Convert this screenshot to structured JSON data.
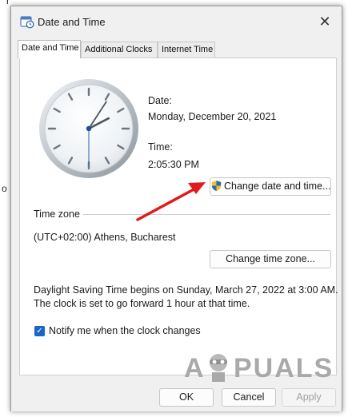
{
  "background": {
    "fragment_top": "r",
    "fragment_left": "o"
  },
  "window": {
    "title": "Date and Time",
    "close_glyph": "✕"
  },
  "tabs": [
    {
      "label": "Date and Time",
      "active": true
    },
    {
      "label": "Additional Clocks",
      "active": false
    },
    {
      "label": "Internet Time",
      "active": false
    }
  ],
  "date": {
    "label": "Date:",
    "value": "Monday, December 20, 2021"
  },
  "time": {
    "label": "Time:",
    "value": "2:05:30 PM",
    "hour": 2,
    "minute": 5,
    "second": 30
  },
  "change_date_time_button": "Change date and time...",
  "time_zone": {
    "heading": "Time zone",
    "value": "(UTC+02:00) Athens, Bucharest",
    "change_button": "Change time zone..."
  },
  "dst": {
    "line1": "Daylight Saving Time begins on Sunday, March 27, 2022 at 3:00 AM.",
    "line2": "The clock is set to go forward 1 hour at that time."
  },
  "notify": {
    "label": "Notify me when the clock changes",
    "checked": true
  },
  "footer": {
    "ok": "OK",
    "cancel": "Cancel",
    "apply": "Apply"
  },
  "watermark": {
    "text_left": "A",
    "text_right": "PUALS"
  },
  "colors": {
    "accent": "#1a66c8",
    "arrow": "#e01b1b",
    "watermark": "#a9a9a9"
  },
  "icons": {
    "app": "date-time-app-icon",
    "shield": "uac-shield-icon",
    "check": "checkmark-icon"
  }
}
